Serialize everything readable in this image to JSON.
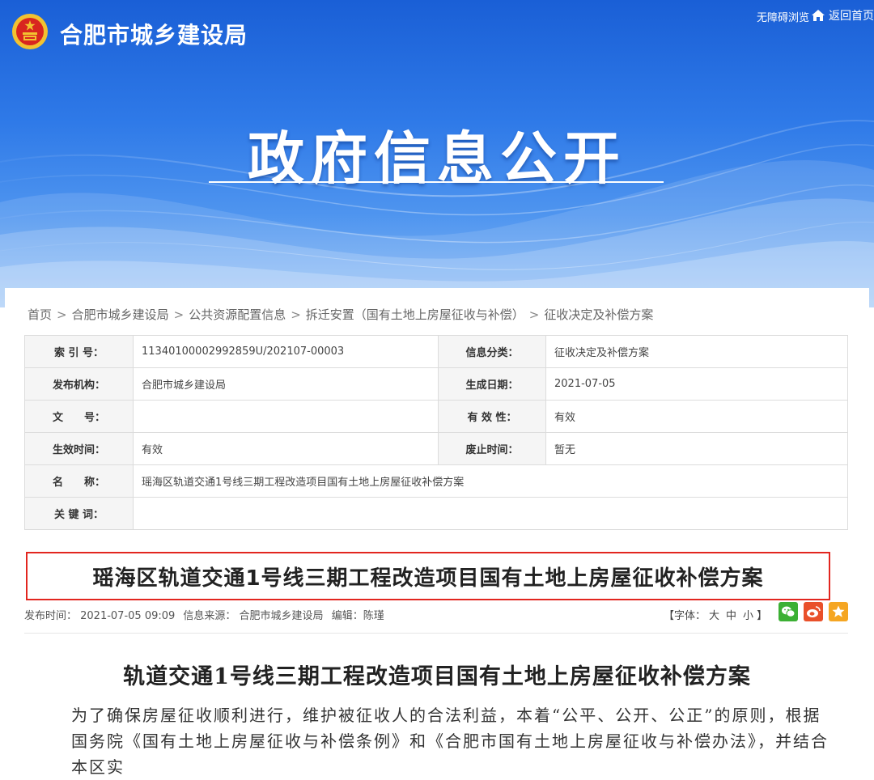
{
  "header": {
    "site_name": "合肥市城乡建设局",
    "accessibility_label": "无障碍浏览",
    "home_label": "返回首页",
    "banner_title": "政府信息公开"
  },
  "breadcrumb": [
    "首页",
    "合肥市城乡建设局",
    "公共资源配置信息",
    "拆迁安置（国有土地上房屋征收与补偿）",
    "征收决定及补偿方案"
  ],
  "breadcrumb_separator": ">",
  "meta": {
    "index_no_label": "索 引 号：",
    "index_no": "11340100002992859U/202107-00003",
    "category_label": "信息分类：",
    "category": "征收决定及补偿方案",
    "publisher_label": "发布机构：",
    "publisher": "合肥市城乡建设局",
    "created_label": "生成日期：",
    "created": "2021-07-05",
    "doc_no_label": "文　　号：",
    "doc_no": "",
    "validity_label": "有 效 性：",
    "validity": "有效",
    "effective_label": "生效时间：",
    "effective": "有效",
    "abolish_label": "废止时间：",
    "abolish": "暂无",
    "name_label": "名　　称：",
    "name": "瑶海区轨道交通1号线三期工程改造项目国有土地上房屋征收补偿方案",
    "keywords_label": "关 键 词：",
    "keywords": ""
  },
  "article": {
    "title": "瑶海区轨道交通1号线三期工程改造项目国有土地上房屋征收补偿方案",
    "publish_time": "发布时间： 2021-07-05 09:09",
    "source": "信息来源： 合肥市城乡建设局",
    "editor": "编辑：陈瑾",
    "font_label_open": "【字体：",
    "font_large": "大",
    "font_medium": "中",
    "font_small": "小",
    "font_label_close": "】",
    "doc_title": "轨道交通1号线三期工程改造项目国有土地上房屋征收补偿方案",
    "body": "为了确保房屋征收顺利进行，维护被征收人的合法利益，本着“公平、公开、公正”的原则，根据国务院《国有土地上房屋征收与补偿条例》和《合肥市国有土地上房屋征收与补偿办法》，并结合本区实"
  },
  "share": [
    {
      "name": "wechat-icon",
      "color": "#3cb034"
    },
    {
      "name": "weibo-icon",
      "color": "#e9502a"
    },
    {
      "name": "favorite-icon",
      "color": "#f5a623"
    }
  ],
  "colors": {
    "banner_blue": "#2f7ae8",
    "title_border_red": "#e2261f"
  }
}
